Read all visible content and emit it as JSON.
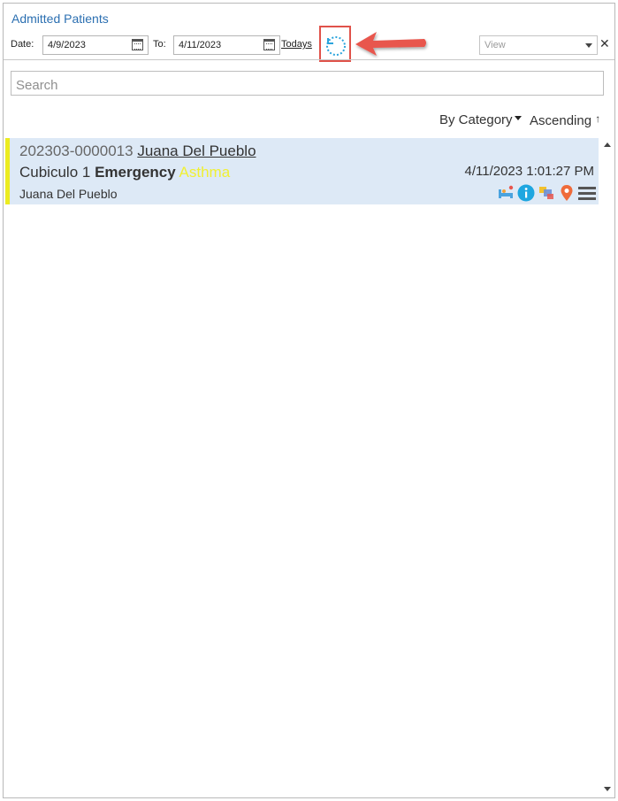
{
  "header": {
    "title": "Admitted Patients"
  },
  "filters": {
    "date_label": "Date:",
    "date_from": "4/9/2023",
    "to_label": "To:",
    "date_to": "4/11/2023",
    "todays_label": "Todays",
    "view_placeholder": "View",
    "clear_symbol": "✕"
  },
  "search": {
    "placeholder": "Search"
  },
  "sort": {
    "category_label": "By Category",
    "order_label": "Ascending",
    "order_symbol": "↑"
  },
  "patients": [
    {
      "record_id": "202303-0000013",
      "name": "Juana Del Pueblo",
      "location": "Cubiculo 1",
      "department": "Emergency",
      "condition": "Asthma",
      "datetime": "4/11/2023 1:01:27 PM",
      "subtitle": "Juana Del Pueblo",
      "flag_color": "#ecec1f",
      "icons": [
        "bed-icon",
        "info-icon",
        "transfer-icon",
        "location-pin-icon",
        "menu-icon"
      ]
    }
  ],
  "colors": {
    "title": "#2b6fb1",
    "row_background": "#dde9f6",
    "condition_text": "#f0f032",
    "highlight_border": "#e0524a",
    "refresh_icon": "#2ba4dc"
  },
  "icons": {
    "refresh": "refresh-icon",
    "calendar": "calendar-icon",
    "annotation_arrow": "red-arrow-icon"
  }
}
